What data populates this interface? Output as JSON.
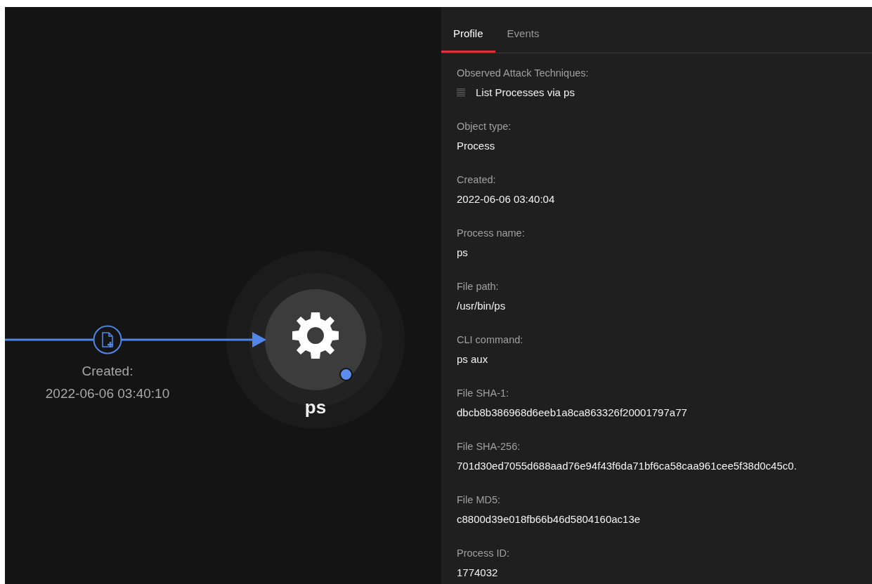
{
  "graph": {
    "edge": {
      "label": "Created:",
      "time": "2022-06-06 03:40:10"
    },
    "node": {
      "name": "ps"
    }
  },
  "panel": {
    "tabs": [
      {
        "label": "Profile",
        "selected": true
      },
      {
        "label": "Events",
        "selected": false
      }
    ],
    "attack_techniques": {
      "label": "Observed Attack Techniques:",
      "items": [
        "List Processes via ps"
      ]
    },
    "fields": [
      {
        "label": "Object type:",
        "value": "Process"
      },
      {
        "label": "Created:",
        "value": "2022-06-06 03:40:04"
      },
      {
        "label": "Process name:",
        "value": "ps"
      },
      {
        "label": "File path:",
        "value": "/usr/bin/ps"
      },
      {
        "label": "CLI command:",
        "value": "ps aux"
      },
      {
        "label": "File SHA-1:",
        "value": "dbcb8b386968d6eeb1a8ca863326f20001797a77"
      },
      {
        "label": "File SHA-256:",
        "value": "701d30ed7055d688aad76e94f43f6da71bf6ca58caa961cee5f38d0c45c0."
      },
      {
        "label": "File MD5:",
        "value": "c8800d39e018fb66b46d5804160ac13e"
      },
      {
        "label": "Process ID:",
        "value": "1774032"
      }
    ]
  }
}
